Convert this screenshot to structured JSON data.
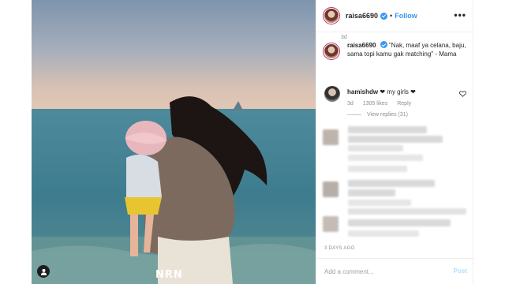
{
  "post": {
    "username": "raisa6690",
    "follow_label": "Follow",
    "separator": "•",
    "more_label": "•••",
    "watermark": "NRN"
  },
  "caption": {
    "username": "raisa6690",
    "text": "\"Nak, maaf ya celana, baju, sama topi kamu gak matching\" - Mama",
    "age": "3d"
  },
  "top_comment": {
    "username": "hamishdw",
    "text": "❤ my girls ❤",
    "age": "3d",
    "likes": "1305 likes",
    "reply_label": "Reply",
    "view_replies": "View replies (31)"
  },
  "timestamp": "3 DAYS AGO",
  "add_comment": {
    "placeholder": "Add a comment...",
    "post_label": "Post"
  },
  "colors": {
    "verified": "#3897f0",
    "follow": "#3897f0",
    "post_disabled": "#b2dffc",
    "story_ring": "#c92b6a"
  },
  "icons": [
    "verified-badge-icon",
    "more-options-icon",
    "heart-icon",
    "user-tag-icon"
  ]
}
